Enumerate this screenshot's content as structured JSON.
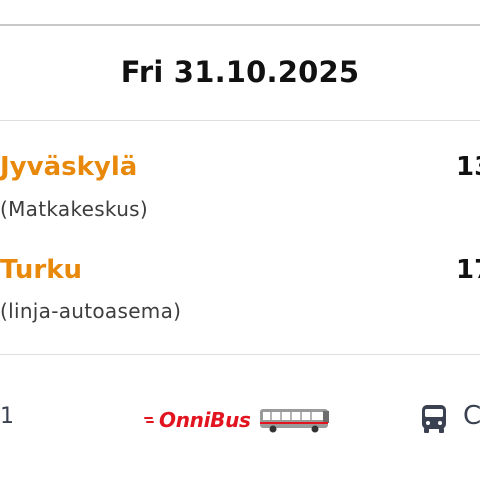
{
  "trip": {
    "date": "Fri 31.10.2025",
    "departure": {
      "city": "Jyväskylä",
      "station": "(Matkakeskus)",
      "time": "13"
    },
    "arrival": {
      "city": "Turku",
      "station": "(linja-autoasema)",
      "time": "17"
    }
  },
  "footer": {
    "leading_text": "1",
    "operator": "OnniBus",
    "operator_icon": "bus-illustration",
    "vehicle_icon": "bus-icon",
    "trailing_text": "C"
  },
  "colors": {
    "accent_orange": "#e8890c",
    "brand_red": "#e1141f",
    "text_dark": "#111111",
    "icon_slate": "#3a4150"
  }
}
